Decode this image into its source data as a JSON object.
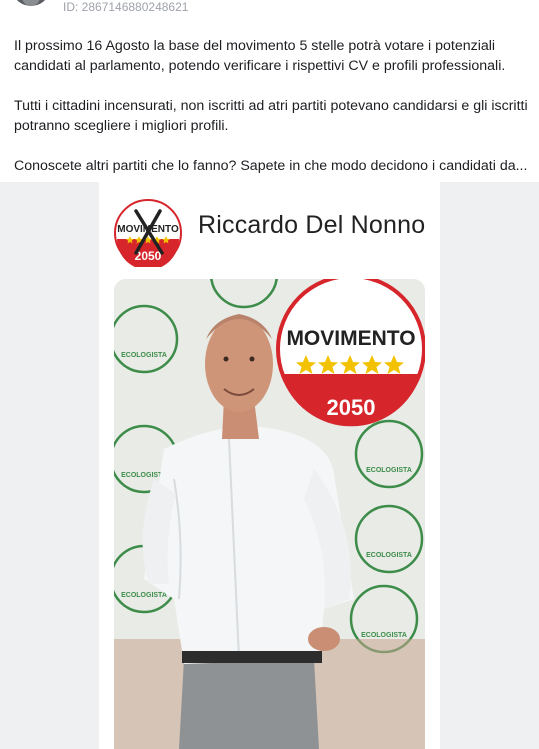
{
  "post": {
    "id_text": "ID: 2867146880248621",
    "paragraphs": [
      "Il prossimo 16 Agosto la base del movimento 5 stelle potrà votare i potenziali candidati al parlamento, potendo verificare i rispettivi CV e profili professionali.",
      "Tutti i cittadini incensurati, non iscritti ad atri partiti potevano candidarsi e gli iscritti potranno scegliere i migliori profili.",
      "Conoscete altri partiti che lo fanno? Sapete in che modo decidono i candidati da..."
    ]
  },
  "image": {
    "name": "Riccardo Del Nonno",
    "logo_word": "MOVIMENTO",
    "logo_year": "2050",
    "wall_logo_word": "ECOLOGISTA",
    "colors": {
      "logo_red": "#d6262b",
      "star_yellow": "#f2c200",
      "wall_green": "#3d8c4a",
      "shirt": "#f4f6f7"
    }
  }
}
